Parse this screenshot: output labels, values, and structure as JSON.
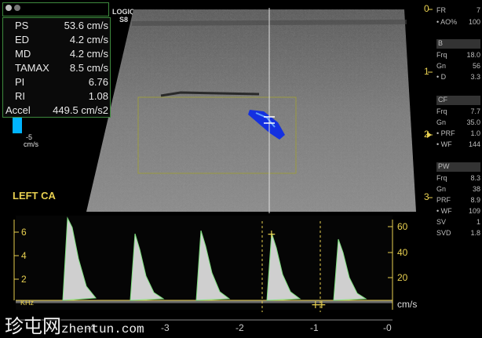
{
  "header": {
    "brand": "LOGIQ",
    "model": "S8"
  },
  "measurements": [
    {
      "label": "PS",
      "value": "53.6 cm/s"
    },
    {
      "label": "ED",
      "value": "4.2 cm/s"
    },
    {
      "label": "MD",
      "value": "4.2 cm/s"
    },
    {
      "label": "TAMAX",
      "value": "8.5 cm/s"
    },
    {
      "label": "PI",
      "value": "6.76"
    },
    {
      "label": "RI",
      "value": "1.08"
    },
    {
      "label": "Accel",
      "value": "449.5 cm/s2"
    }
  ],
  "color_scale": {
    "min_label": "-5",
    "unit": "cm/s"
  },
  "annotation": "LEFT CA",
  "depth_scale": [
    "0",
    "1",
    "2",
    "3"
  ],
  "right_panel": {
    "fr": {
      "k": "FR",
      "v": "7"
    },
    "ao": {
      "k": "AO%",
      "v": "100"
    },
    "b_title": "B",
    "b": [
      {
        "k": "Frq",
        "v": "18.0"
      },
      {
        "k": "Gn",
        "v": "56"
      },
      {
        "k": "D",
        "v": "3.3"
      }
    ],
    "cf_title": "CF",
    "cf": [
      {
        "k": "Frq",
        "v": "7.7"
      },
      {
        "k": "Gn",
        "v": "35.0"
      },
      {
        "k": "PRF",
        "v": "1.0"
      },
      {
        "k": "WF",
        "v": "144"
      }
    ],
    "pw_title": "PW",
    "pw": [
      {
        "k": "Frq",
        "v": "8.3"
      },
      {
        "k": "Gn",
        "v": "38"
      },
      {
        "k": "PRF",
        "v": "8.9"
      },
      {
        "k": "WF",
        "v": "109"
      },
      {
        "k": "SV",
        "v": "1"
      },
      {
        "k": "SVD",
        "v": "1.8"
      }
    ]
  },
  "doppler": {
    "left_scale": [
      "6",
      "4",
      "2"
    ],
    "kHz": "KHz",
    "right_scale": [
      "60",
      "40",
      "20"
    ],
    "right_unit": "cm/s",
    "time_labels": [
      "-4",
      "-3",
      "-2",
      "-1",
      "-0"
    ]
  },
  "watermark": {
    "cn": "珍屯网",
    "url": "zhentun.com"
  },
  "colors": {
    "frame": "#3e8a3e",
    "scale": "#e8d050",
    "flow": "#1430e0",
    "accent": "#00b4ff"
  }
}
